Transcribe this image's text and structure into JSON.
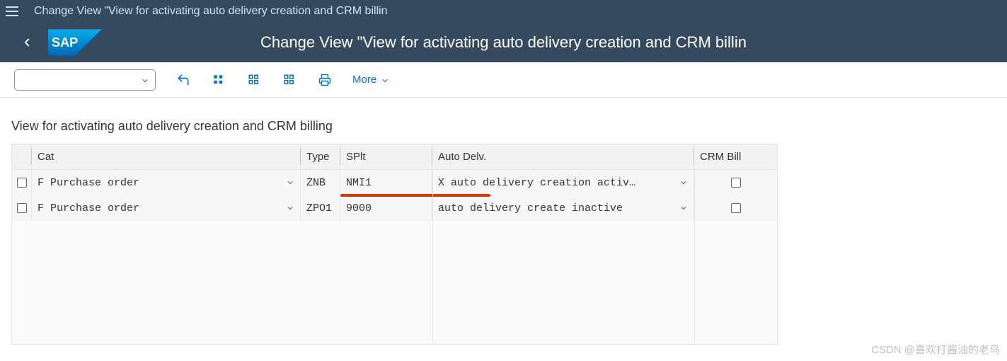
{
  "topbar": {
    "title": "Change View \"View for activating auto delivery creation and CRM billin"
  },
  "header": {
    "title": "Change View \"View for activating auto delivery creation and CRM billin"
  },
  "toolbar": {
    "more_label": "More"
  },
  "section": {
    "title": "View for activating auto delivery creation and CRM billing"
  },
  "columns": {
    "cat": "Cat",
    "type": "Type",
    "splt": "SPlt",
    "auto": "Auto Delv.",
    "crm": "CRM Bill"
  },
  "rows": [
    {
      "cat": "F Purchase order",
      "type": "ZNB",
      "splt": "NMI1",
      "auto": "X auto delivery creation activ…",
      "crm_checked": false
    },
    {
      "cat": "F Purchase order",
      "type": "ZPO1",
      "splt": "9000",
      "auto": " auto delivery create inactive",
      "crm_checked": false
    }
  ],
  "watermark": "CSDN @喜欢打酱油的老鸟"
}
